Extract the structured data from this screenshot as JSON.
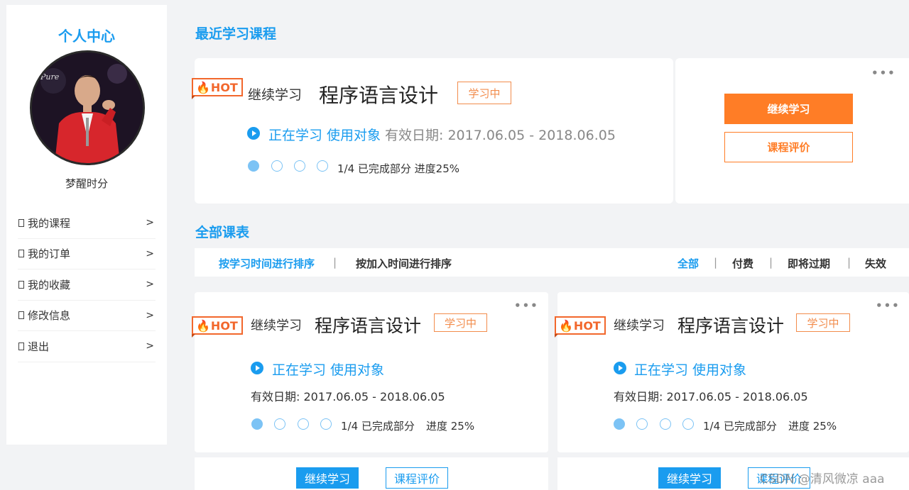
{
  "sidebar": {
    "title": "个人中心",
    "username": "梦醒时分",
    "avatar_text": "Pure",
    "menu": [
      {
        "label": "我的课程",
        "arrow": ">"
      },
      {
        "label": "我的订单",
        "arrow": ">"
      },
      {
        "label": "我的收藏",
        "arrow": ">"
      },
      {
        "label": "修改信息",
        "arrow": ">"
      },
      {
        "label": "退出",
        "arrow": ">"
      }
    ]
  },
  "recent": {
    "section_title": "最近学习课程",
    "hot_label": "HOT",
    "continue_text": "继续学习",
    "course_title": "程序语言设计",
    "status": "学习中",
    "learning_link": "正在学习 使用对象",
    "valid_period": "有效日期: 2017.06.05 - 2018.06.05",
    "progress_text": "1/4 已完成部分 进度25%",
    "progress": {
      "completed": 1,
      "total": 4
    },
    "more": "•••",
    "btn_continue": "继续学习",
    "btn_review": "课程评价"
  },
  "all_courses": {
    "section_title": "全部课表",
    "sort_by_study_time": "按学习时间进行排序",
    "sort_by_add_time": "按加入时间进行排序",
    "separator": "|",
    "filters": [
      "全部",
      "付费",
      "即将过期",
      "失效"
    ],
    "cards": [
      {
        "hot_label": "HOT",
        "continue_text": "继续学习",
        "course_title": "程序语言设计",
        "status": "学习中",
        "learning_link": "正在学习 使用对象",
        "valid_period": "有效日期: 2017.06.05 - 2018.06.05",
        "progress_text": "1/4 已完成部分",
        "progress_percent": "进度 25%",
        "progress": {
          "completed": 1,
          "total": 4
        },
        "more": "•••",
        "btn_continue": "继续学习",
        "btn_review": "课程评价"
      },
      {
        "hot_label": "HOT",
        "continue_text": "继续学习",
        "course_title": "程序语言设计",
        "status": "学习中",
        "learning_link": "正在学习 使用对象",
        "valid_period": "有效日期: 2017.06.05 - 2018.06.05",
        "progress_text": "1/4 已完成部分",
        "progress_percent": "进度 25%",
        "progress": {
          "completed": 1,
          "total": 4
        },
        "more": "•••",
        "btn_continue": "继续学习",
        "btn_review": "课程评价"
      }
    ]
  },
  "watermark": "CSDN @清风微凉 aaa",
  "colors": {
    "accent_blue": "#1a9cef",
    "accent_orange": "#ff7d26",
    "background": "#f2f3f5"
  }
}
